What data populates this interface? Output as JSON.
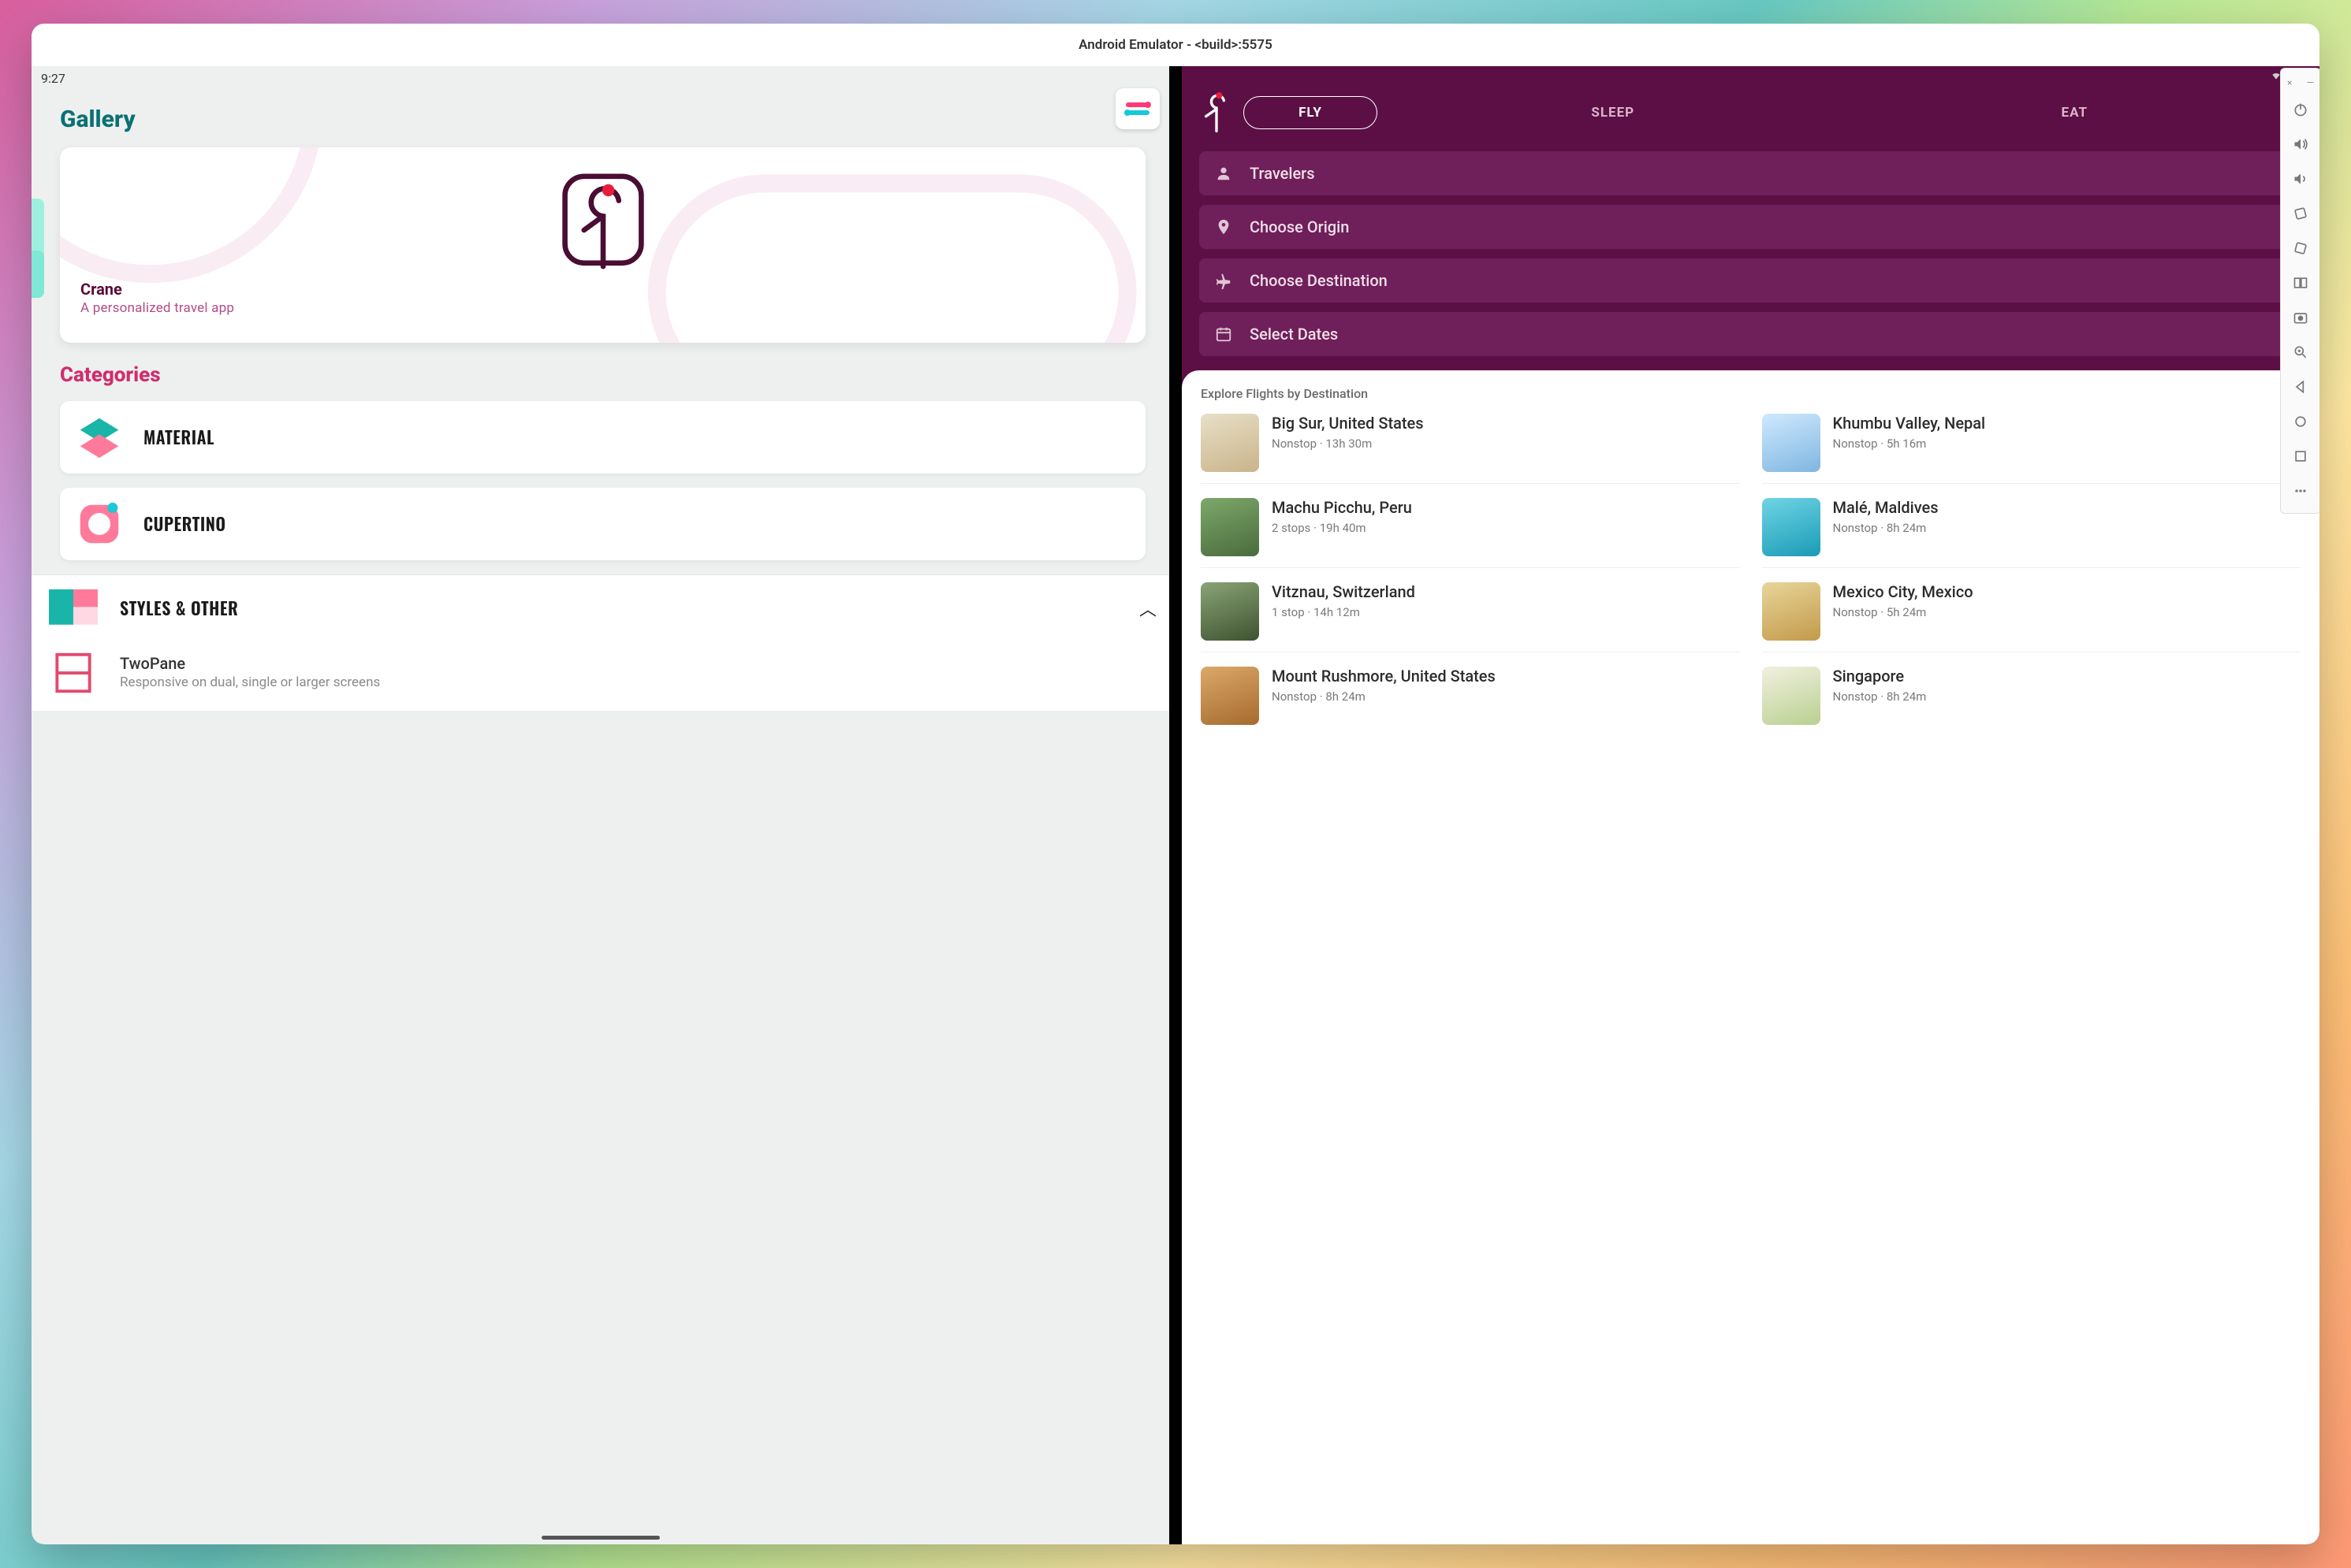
{
  "window": {
    "title": "Android Emulator - <build>:5575"
  },
  "left": {
    "clock": "9:27",
    "title": "Gallery",
    "hero": {
      "name": "Crane",
      "sub": "A personalized travel app"
    },
    "categories_title": "Categories",
    "categories": [
      {
        "label": "MATERIAL"
      },
      {
        "label": "CUPERTINO"
      }
    ],
    "styles": {
      "label": "STYLES & OTHER"
    },
    "twopane": {
      "title": "TwoPane",
      "sub": "Responsive on dual, single or larger screens"
    }
  },
  "right": {
    "tabs": {
      "fly": "FLY",
      "sleep": "SLEEP",
      "eat": "EAT"
    },
    "search": {
      "travelers": "Travelers",
      "origin": "Choose Origin",
      "destination": "Choose Destination",
      "dates": "Select Dates"
    },
    "sheet_title": "Explore Flights by Destination",
    "destinations": [
      {
        "name": "Big Sur, United States",
        "meta": "Nonstop · 13h 30m"
      },
      {
        "name": "Khumbu Valley, Nepal",
        "meta": "Nonstop · 5h 16m"
      },
      {
        "name": "Machu Picchu, Peru",
        "meta": "2 stops · 19h 40m"
      },
      {
        "name": "Malé, Maldives",
        "meta": "Nonstop · 8h 24m"
      },
      {
        "name": "Vitznau, Switzerland",
        "meta": "1 stop · 14h 12m"
      },
      {
        "name": "Mexico City, Mexico",
        "meta": "Nonstop · 5h 24m"
      },
      {
        "name": "Mount Rushmore, United States",
        "meta": "Nonstop · 8h 24m"
      },
      {
        "name": "Singapore",
        "meta": "Nonstop · 8h 24m"
      }
    ]
  }
}
